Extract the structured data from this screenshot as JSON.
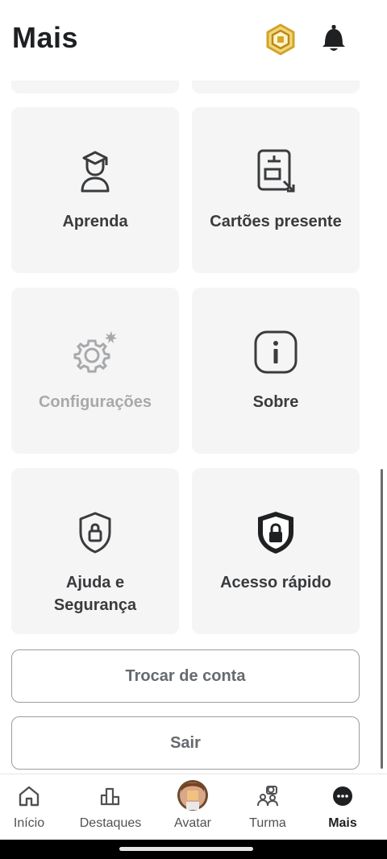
{
  "header": {
    "title": "Mais"
  },
  "tiles": {
    "learn": {
      "label": "Aprenda"
    },
    "gift_cards": {
      "label": "Cartões presente"
    },
    "settings": {
      "label": "Configurações"
    },
    "about": {
      "label": "Sobre"
    },
    "help_safety": {
      "label_line1": "Ajuda e",
      "label_line2": "Segurança"
    },
    "quick_access": {
      "label": "Acesso rápido"
    }
  },
  "buttons": {
    "switch_account": "Trocar de conta",
    "logout": "Sair"
  },
  "nav": {
    "items": [
      {
        "label": "Início",
        "icon": "home-icon"
      },
      {
        "label": "Destaques",
        "icon": "charts-icon"
      },
      {
        "label": "Avatar",
        "icon": "avatar-icon"
      },
      {
        "label": "Turma",
        "icon": "friends-icon"
      },
      {
        "label": "Mais",
        "icon": "more-icon"
      }
    ],
    "active": "Mais"
  },
  "colors": {
    "tile_bg": "#f5f5f6",
    "text": "#393b3d",
    "disabled_text": "#a7a9ab",
    "robux_gold": "#e2b93b"
  }
}
